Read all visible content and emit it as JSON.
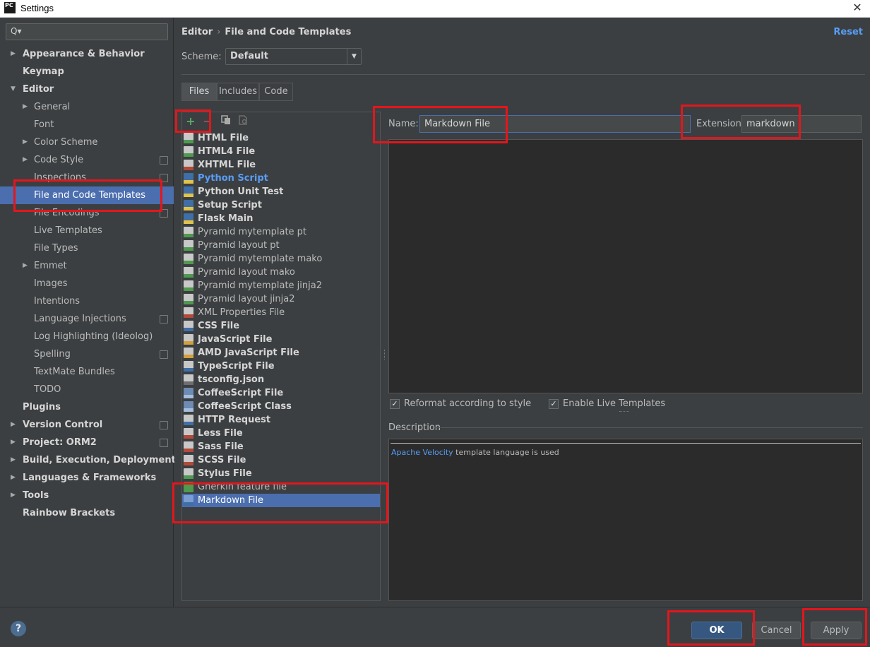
{
  "window": {
    "title": "Settings",
    "app_icon": "PC"
  },
  "search": {
    "glyph": "Q▾",
    "placeholder": ""
  },
  "sidebar": {
    "items": [
      {
        "label": "Appearance & Behavior"
      },
      {
        "label": "Keymap"
      },
      {
        "label": "Editor"
      },
      {
        "label": "General"
      },
      {
        "label": "Font"
      },
      {
        "label": "Color Scheme"
      },
      {
        "label": "Code Style"
      },
      {
        "label": "Inspections"
      },
      {
        "label": "File and Code Templates"
      },
      {
        "label": "File Encodings"
      },
      {
        "label": "Live Templates"
      },
      {
        "label": "File Types"
      },
      {
        "label": "Emmet"
      },
      {
        "label": "Images"
      },
      {
        "label": "Intentions"
      },
      {
        "label": "Language Injections"
      },
      {
        "label": "Log Highlighting (Ideolog)"
      },
      {
        "label": "Spelling"
      },
      {
        "label": "TextMate Bundles"
      },
      {
        "label": "TODO"
      },
      {
        "label": "Plugins"
      },
      {
        "label": "Version Control"
      },
      {
        "label": "Project: ORM2"
      },
      {
        "label": "Build, Execution, Deployment"
      },
      {
        "label": "Languages & Frameworks"
      },
      {
        "label": "Tools"
      },
      {
        "label": "Rainbow Brackets"
      }
    ],
    "selected": "File and Code Templates"
  },
  "header": {
    "breadcrumb_root": "Editor",
    "breadcrumb_sep": "›",
    "breadcrumb_page": "File and Code Templates",
    "reset_label": "Reset"
  },
  "scheme": {
    "label": "Scheme:",
    "value": "Default"
  },
  "tabs": [
    {
      "label": "Files",
      "active": true
    },
    {
      "label": "Includes",
      "active": false
    },
    {
      "label": "Code",
      "active": false
    }
  ],
  "toolbar": {
    "add": "+",
    "remove": "−"
  },
  "templates": [
    {
      "label": "HTML File"
    },
    {
      "label": "HTML4 File"
    },
    {
      "label": "XHTML File"
    },
    {
      "label": "Python Script"
    },
    {
      "label": "Python Unit Test"
    },
    {
      "label": "Setup Script"
    },
    {
      "label": "Flask Main"
    },
    {
      "label": "Pyramid mytemplate pt"
    },
    {
      "label": "Pyramid layout pt"
    },
    {
      "label": "Pyramid mytemplate mako"
    },
    {
      "label": "Pyramid layout mako"
    },
    {
      "label": "Pyramid mytemplate jinja2"
    },
    {
      "label": "Pyramid layout jinja2"
    },
    {
      "label": "XML Properties File"
    },
    {
      "label": "CSS File"
    },
    {
      "label": "JavaScript File"
    },
    {
      "label": "AMD JavaScript File"
    },
    {
      "label": "TypeScript File"
    },
    {
      "label": "tsconfig.json"
    },
    {
      "label": "CoffeeScript File"
    },
    {
      "label": "CoffeeScript Class"
    },
    {
      "label": "HTTP Request"
    },
    {
      "label": "Less File"
    },
    {
      "label": "Sass File"
    },
    {
      "label": "SCSS File"
    },
    {
      "label": "Stylus File"
    },
    {
      "label": "Gherkin feature file"
    },
    {
      "label": "Markdown File"
    }
  ],
  "form": {
    "name_label": "Name:",
    "name_value": "Markdown File",
    "ext_label": "Extension:",
    "ext_value": "markdown"
  },
  "options": {
    "reformat_label": "Reformat according to style",
    "live_label": "Enable Live Templates",
    "check_glyph": "✓"
  },
  "description": {
    "label": "Description",
    "link": "Apache Velocity",
    "text": " template language is used"
  },
  "footer": {
    "help": "?",
    "ok_label": "OK",
    "cancel_label": "Cancel",
    "apply_label": "Apply"
  },
  "colors": {
    "background": "#3c3f41",
    "editor_bg": "#2b2b2b",
    "selection": "#4b6eaf",
    "link": "#589df6",
    "annotation_red": "#e3161c",
    "primary_button": "#365880"
  }
}
